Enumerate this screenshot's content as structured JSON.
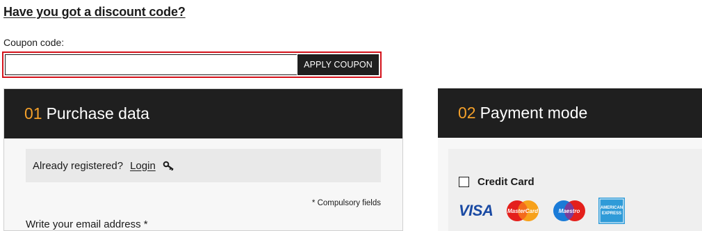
{
  "discount": {
    "title": "Have you got a discount code?",
    "coupon_label": "Coupon code:",
    "coupon_value": "",
    "apply_label": "APPLY COUPON"
  },
  "purchase": {
    "step": "01",
    "title": "Purchase data",
    "already_registered": "Already registered?",
    "login_label": "Login",
    "compulsory_note": "* Compulsory fields",
    "email_label": "Write your email address *"
  },
  "payment": {
    "step": "02",
    "title": "Payment mode",
    "credit_card_label": "Credit Card",
    "cards": [
      {
        "name": "VISA",
        "icon": "visa-logo"
      },
      {
        "name": "MasterCard",
        "icon": "mastercard-logo"
      },
      {
        "name": "Maestro",
        "icon": "maestro-logo"
      },
      {
        "name": "AMERICAN EXPRESS",
        "icon": "amex-logo"
      }
    ]
  },
  "colors": {
    "accent_orange": "#f4a02a",
    "header_dark": "#1f1f1f",
    "highlight_red": "#d4121b"
  }
}
